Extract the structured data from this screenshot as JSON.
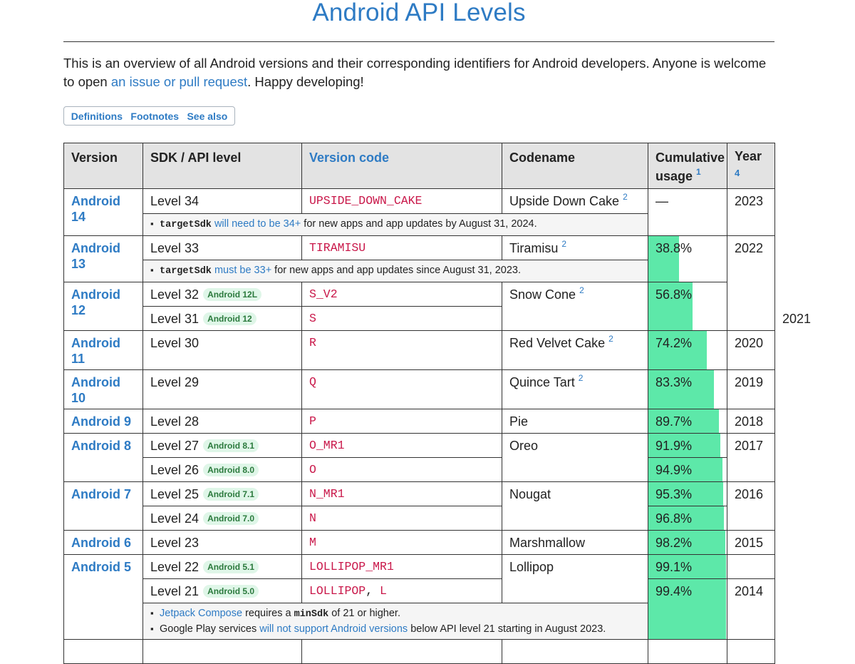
{
  "title": "Android API Levels",
  "intro": {
    "text_before": "This is an overview of all Android versions and their corresponding identifiers for Android developers. Anyone is welcome to open ",
    "link": "an issue or pull request",
    "text_after": ". Happy developing!"
  },
  "tabs": [
    "Definitions",
    "Footnotes",
    "See also"
  ],
  "headers": {
    "version": "Version",
    "sdk": "SDK / API level",
    "code": "Version code",
    "codename": "Codename",
    "usage": "Cumulative usage",
    "usage_fn": "1",
    "year": "Year",
    "year_fn": "4"
  },
  "rows": [
    {
      "version": "Android 14",
      "level": "Level 34",
      "badge": "",
      "code": "UPSIDE_DOWN_CAKE",
      "codename": "Upside Down Cake",
      "fn": "2",
      "usage": "—",
      "usage_value": 0,
      "year": "2023"
    },
    {
      "version": "Android 13",
      "level": "Level 33",
      "badge": "",
      "code": "TIRAMISU",
      "codename": "Tiramisu",
      "fn": "2",
      "usage": "38.8%",
      "usage_value": 38.8,
      "year": "2022"
    },
    {
      "version": "Android 12",
      "level": "Level 32",
      "badge": "Android 12L",
      "code": "S_V2",
      "codename": "Snow Cone",
      "fn": "2",
      "usage": "56.8%",
      "usage_value": 56.8,
      "year": ""
    },
    {
      "version": "",
      "level": "Level 31",
      "badge": "Android 12",
      "code": "S",
      "codename": "",
      "fn": "",
      "usage": "",
      "usage_value": 56.8,
      "year": "2021"
    },
    {
      "version": "Android 11",
      "level": "Level 30",
      "badge": "",
      "code": "R",
      "codename": "Red Velvet Cake",
      "fn": "2",
      "usage": "74.2%",
      "usage_value": 74.2,
      "year": "2020"
    },
    {
      "version": "Android 10",
      "level": "Level 29",
      "badge": "",
      "code": "Q",
      "codename": "Quince Tart",
      "fn": "2",
      "usage": "83.3%",
      "usage_value": 83.3,
      "year": "2019"
    },
    {
      "version": "Android 9",
      "level": "Level 28",
      "badge": "",
      "code": "P",
      "codename": "Pie",
      "fn": "",
      "usage": "89.7%",
      "usage_value": 89.7,
      "year": "2018"
    },
    {
      "version": "Android 8",
      "level": "Level 27",
      "badge": "Android 8.1",
      "code": "O_MR1",
      "codename": "Oreo",
      "fn": "",
      "usage": "91.9%",
      "usage_value": 91.9,
      "year": "2017"
    },
    {
      "version": "",
      "level": "Level 26",
      "badge": "Android 8.0",
      "code": "O",
      "codename": "",
      "fn": "",
      "usage": "94.9%",
      "usage_value": 94.9,
      "year": ""
    },
    {
      "version": "Android 7",
      "level": "Level 25",
      "badge": "Android 7.1",
      "code": "N_MR1",
      "codename": "Nougat",
      "fn": "",
      "usage": "95.3%",
      "usage_value": 95.3,
      "year": "2016"
    },
    {
      "version": "",
      "level": "Level 24",
      "badge": "Android 7.0",
      "code": "N",
      "codename": "",
      "fn": "",
      "usage": "96.8%",
      "usage_value": 96.8,
      "year": ""
    },
    {
      "version": "Android 6",
      "level": "Level 23",
      "badge": "",
      "code": "M",
      "codename": "Marshmallow",
      "fn": "",
      "usage": "98.2%",
      "usage_value": 98.2,
      "year": "2015"
    },
    {
      "version": "Android 5",
      "level": "Level 22",
      "badge": "Android 5.1",
      "code": "LOLLIPOP_MR1",
      "codename": "Lollipop",
      "fn": "",
      "usage": "99.1%",
      "usage_value": 99.1,
      "year": ""
    },
    {
      "version": "",
      "level": "Level 21",
      "badge": "Android 5.0",
      "code": "LOLLIPOP",
      "code2": "L",
      "codename": "",
      "fn": "",
      "usage": "99.4%",
      "usage_value": 99.4,
      "year": "2014"
    }
  ],
  "notes": {
    "a14": {
      "code": "targetSdk",
      "link": "will need to be 34+",
      "text": " for new apps and app updates by August 31, 2024."
    },
    "a13": {
      "code": "targetSdk",
      "link": "must be 33+",
      "text": " for new apps and app updates since August 31, 2023."
    },
    "a5": [
      {
        "link": "Jetpack Compose",
        "text1": " requires a ",
        "code": "minSdk",
        "text2": " of 21 or higher."
      },
      {
        "text1": "Google Play services ",
        "link": "will not support Android versions",
        "text2": " below API level 21 starting in August 2023."
      }
    ]
  }
}
